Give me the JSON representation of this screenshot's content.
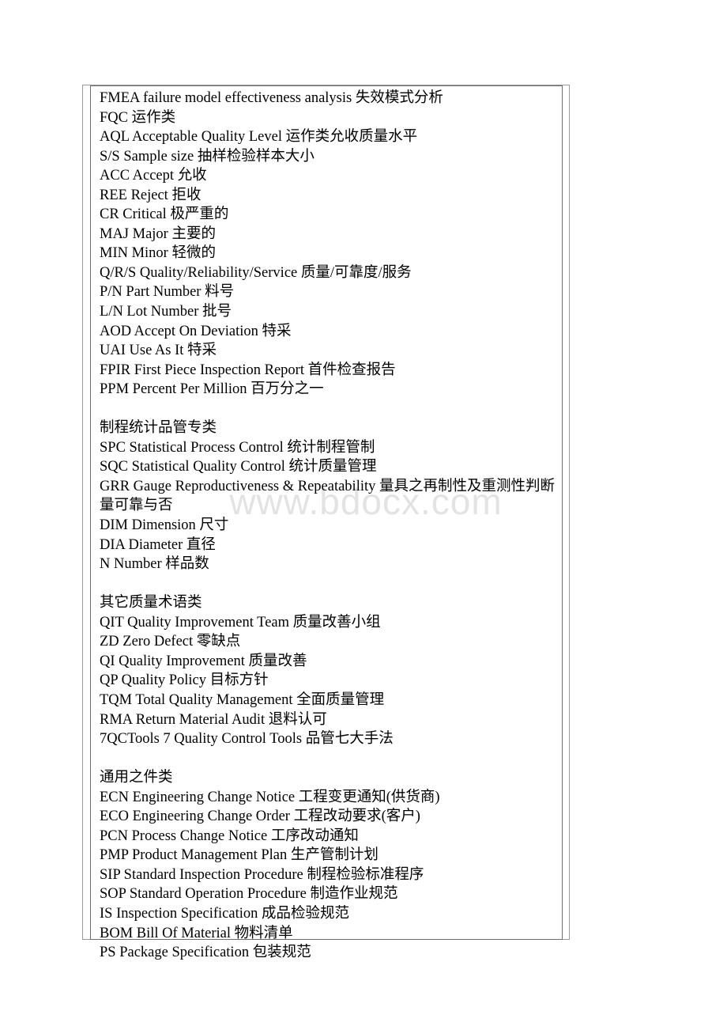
{
  "document": {
    "watermark": "www.bdocx.com",
    "box": {
      "lines": [
        {
          "id": "fmea",
          "type": "entry",
          "text": "FMEA failure model effectiveness analysis 失效模式分析"
        },
        {
          "id": "fqc",
          "type": "entry",
          "text": "FQC 运作类"
        },
        {
          "id": "aql",
          "type": "entry",
          "text": "AQL Acceptable Quality Level 运作类允收质量水平"
        },
        {
          "id": "ss",
          "type": "entry",
          "text": "S/S Sample size 抽样检验样本大小"
        },
        {
          "id": "acc",
          "type": "entry",
          "text": "ACC Accept 允收"
        },
        {
          "id": "ree",
          "type": "entry",
          "text": "REE Reject 拒收"
        },
        {
          "id": "cr",
          "type": "entry",
          "text": "CR Critical 极严重的"
        },
        {
          "id": "maj",
          "type": "entry",
          "text": "MAJ Major 主要的"
        },
        {
          "id": "min",
          "type": "entry",
          "text": "MIN Minor 轻微的"
        },
        {
          "id": "qrs",
          "type": "entry",
          "text": "Q/R/S Quality/Reliability/Service 质量/可靠度/服务"
        },
        {
          "id": "pn",
          "type": "entry",
          "text": "P/N Part Number 料号"
        },
        {
          "id": "ln",
          "type": "entry",
          "text": "L/N Lot Number 批号"
        },
        {
          "id": "aod",
          "type": "entry",
          "text": "AOD Accept On Deviation 特采"
        },
        {
          "id": "uai",
          "type": "entry",
          "text": "UAI Use As It 特采"
        },
        {
          "id": "fpir",
          "type": "entry",
          "text": "FPIR First Piece Inspection Report 首件检查报告"
        },
        {
          "id": "ppm",
          "type": "entry",
          "text": "PPM Percent Per Million 百万分之一"
        },
        {
          "id": "gap-1",
          "type": "blank",
          "text": ""
        },
        {
          "id": "sec-spc",
          "type": "section",
          "text": "制程统计品管专类"
        },
        {
          "id": "spc",
          "type": "entry",
          "text": "SPC Statistical Process Control 统计制程管制"
        },
        {
          "id": "sqc",
          "type": "entry",
          "text": "SQC Statistical Quality Control 统计质量管理"
        },
        {
          "id": "grr",
          "type": "entry",
          "text": "GRR Gauge Reproductiveness & Repeatability 量具之再制性及重测性判断量可靠与否"
        },
        {
          "id": "dim",
          "type": "entry",
          "text": "DIM Dimension 尺寸"
        },
        {
          "id": "dia",
          "type": "entry",
          "text": "DIA Diameter 直径"
        },
        {
          "id": "n",
          "type": "entry",
          "text": "N Number 样品数"
        },
        {
          "id": "gap-2",
          "type": "blank",
          "text": ""
        },
        {
          "id": "sec-other",
          "type": "section",
          "text": "其它质量术语类"
        },
        {
          "id": "qit",
          "type": "entry",
          "text": "QIT Quality Improvement Team 质量改善小组"
        },
        {
          "id": "zd",
          "type": "entry",
          "text": "ZD Zero Defect 零缺点"
        },
        {
          "id": "qi",
          "type": "entry",
          "text": "QI Quality Improvement 质量改善"
        },
        {
          "id": "qp",
          "type": "entry",
          "text": "QP Quality Policy 目标方针"
        },
        {
          "id": "tqm",
          "type": "entry",
          "text": "TQM Total Quality Management 全面质量管理"
        },
        {
          "id": "rma",
          "type": "entry",
          "text": "RMA Return Material Audit 退料认可"
        },
        {
          "id": "7qctools",
          "type": "entry",
          "text": "7QCTools 7 Quality Control Tools 品管七大手法"
        },
        {
          "id": "gap-3",
          "type": "blank",
          "text": ""
        },
        {
          "id": "sec-gen",
          "type": "section",
          "text": "通用之件类"
        },
        {
          "id": "ecn",
          "type": "entry",
          "text": "ECN Engineering Change Notice 工程变更通知(供货商)"
        },
        {
          "id": "eco",
          "type": "entry",
          "text": "ECO Engineering Change Order 工程改动要求(客户)"
        },
        {
          "id": "pcn",
          "type": "entry",
          "text": "PCN Process Change Notice 工序改动通知"
        },
        {
          "id": "pmp",
          "type": "entry",
          "text": "PMP Product Management Plan 生产管制计划"
        },
        {
          "id": "sip",
          "type": "entry",
          "text": "SIP Standard Inspection Procedure 制程检验标准程序"
        },
        {
          "id": "sop",
          "type": "entry",
          "text": "SOP Standard Operation Procedure 制造作业规范"
        },
        {
          "id": "is",
          "type": "entry",
          "text": "IS Inspection Specification 成品检验规范"
        },
        {
          "id": "bom",
          "type": "entry",
          "text": "BOM Bill Of Material 物料清单"
        },
        {
          "id": "ps",
          "type": "entry",
          "text": "PS Package Specification 包装规范"
        }
      ]
    }
  }
}
